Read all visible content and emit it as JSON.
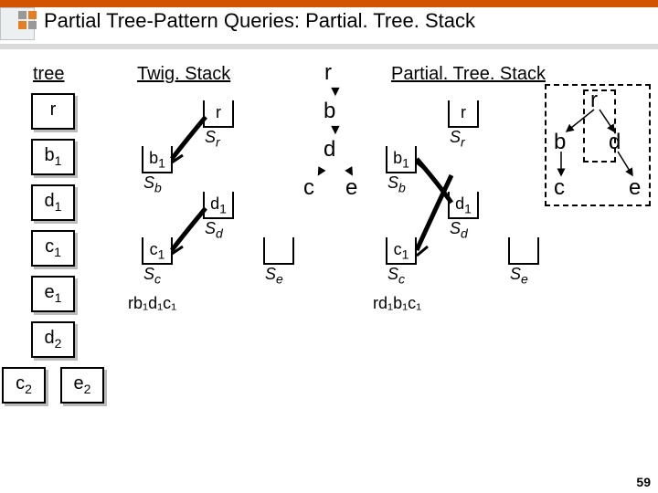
{
  "title": "Partial Tree-Pattern Queries: Partial. Tree. Stack",
  "labels": {
    "tree": "tree",
    "twig": "Twig. Stack",
    "pt": "Partial. Tree. Stack"
  },
  "tree": {
    "r": "r",
    "b1": "b",
    "b1s": "1",
    "d1": "d",
    "d1s": "1",
    "c1": "c",
    "c1s": "1",
    "e1": "e",
    "e1s": "1",
    "d2": "d",
    "d2s": "2",
    "c2": "c",
    "c2s": "2",
    "e2": "e",
    "e2s": "2"
  },
  "stacks": {
    "r": "r",
    "Sr": "S",
    "Srs": "r",
    "b1": "b",
    "b1s": "1",
    "Sb": "S",
    "Sbs": "b",
    "d1": "d",
    "d1s": "1",
    "Sd": "S",
    "Sds": "d",
    "c1": "c",
    "c1s": "1",
    "Sc": "S",
    "Scs": "c",
    "Se": "S",
    "Ses": "e"
  },
  "paths": {
    "twig": "rb₁d₁c₁",
    "pt": "rd₁b₁c₁"
  },
  "query": {
    "r": "r",
    "b": "b",
    "d": "d",
    "c": "c",
    "e": "e"
  },
  "pagenum": "59"
}
